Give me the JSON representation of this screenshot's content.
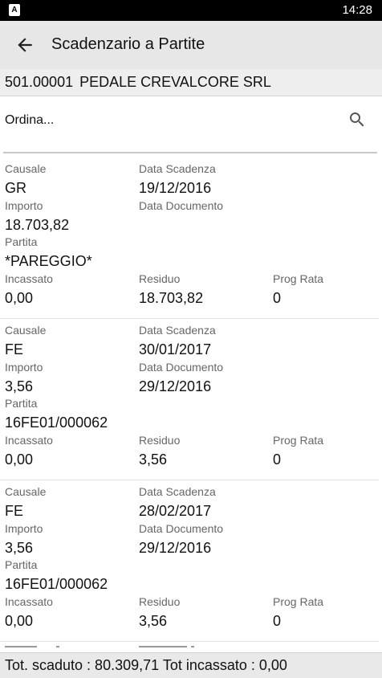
{
  "status_bar": {
    "time": "14:28",
    "app_icon": "A"
  },
  "app_bar": {
    "title": "Scadenzario a Partite",
    "back_icon": "arrow-back-icon"
  },
  "customer": {
    "code": "501.00001",
    "name": "PEDALE CREVALCORE SRL"
  },
  "sort": {
    "placeholder": "Ordina...",
    "search_icon": "search-icon"
  },
  "labels": {
    "causale": "Causale",
    "data_scadenza": "Data Scadenza",
    "importo": "Importo",
    "data_documento": "Data Documento",
    "partita": "Partita",
    "incassato": "Incassato",
    "residuo": "Residuo",
    "prog_rata": "Prog Rata"
  },
  "items": [
    {
      "causale": "GR",
      "data_scadenza": "19/12/2016",
      "importo": "18.703,82",
      "data_documento": "",
      "partita": "*PAREGGIO*",
      "incassato": "0,00",
      "residuo": "18.703,82",
      "prog_rata": "0"
    },
    {
      "causale": "FE",
      "data_scadenza": "30/01/2017",
      "importo": "3,56",
      "data_documento": "29/12/2016",
      "partita": "16FE01/000062",
      "incassato": "0,00",
      "residuo": "3,56",
      "prog_rata": "0"
    },
    {
      "causale": "FE",
      "data_scadenza": "28/02/2017",
      "importo": "3,56",
      "data_documento": "29/12/2016",
      "partita": "16FE01/000062",
      "incassato": "0,00",
      "residuo": "3,56",
      "prog_rata": "0"
    }
  ],
  "footer": {
    "text": "Tot. scaduto : 80.309,71 Tot incassato : 0,00"
  }
}
